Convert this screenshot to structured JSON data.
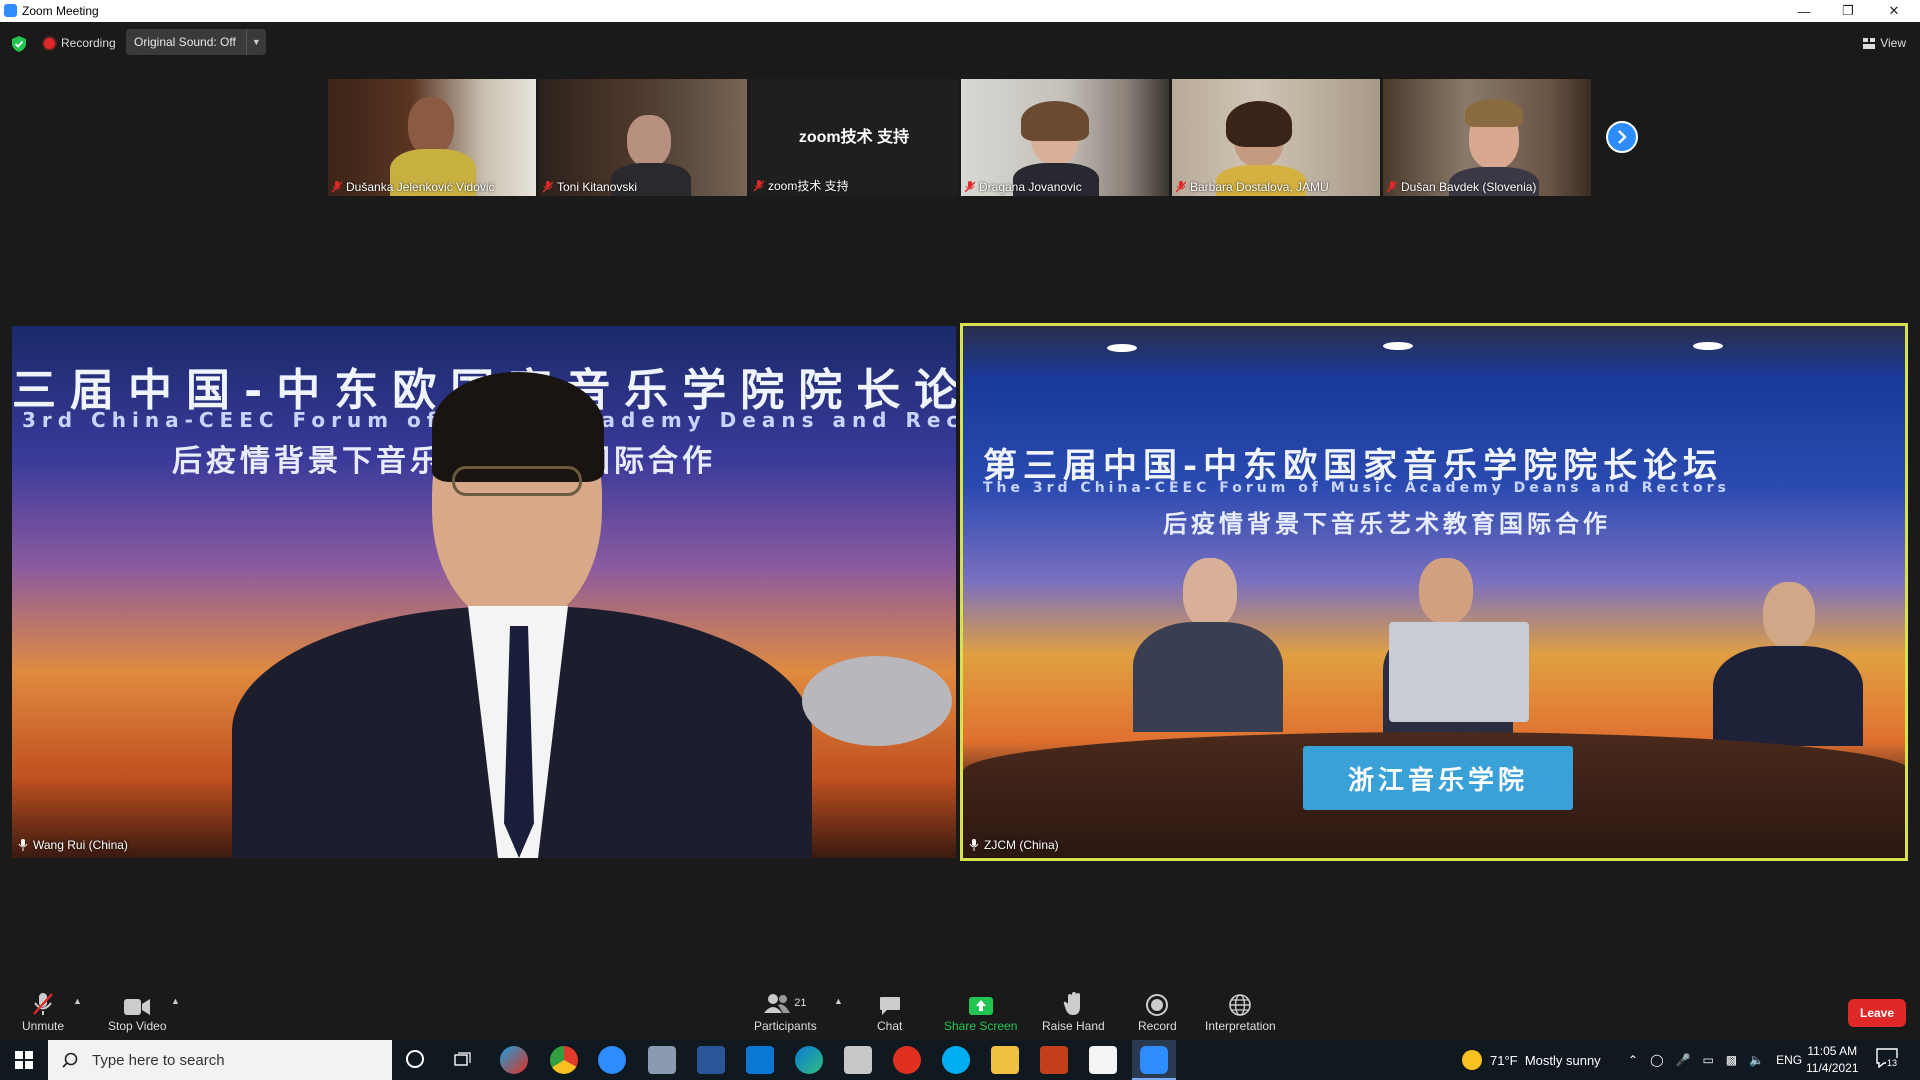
{
  "window": {
    "title": "Zoom Meeting"
  },
  "topbar": {
    "recording_label": "Recording",
    "original_sound_label": "Original Sound: Off",
    "view_label": "View"
  },
  "thumbnails": [
    {
      "name": "Dušanka Jelenković Vidović"
    },
    {
      "name": "Toni Kitanovski"
    },
    {
      "name": "zoom技术 支持",
      "center_text": "zoom技术 支持"
    },
    {
      "name": "Dragana Jovanovic"
    },
    {
      "name": "Barbara Dostalova, JAMU"
    },
    {
      "name": "Dušan Bavdek (Slovenia)"
    }
  ],
  "main_videos": {
    "left": {
      "name": "Wang Rui (China)",
      "banner_line1": "三届中国-中东欧国家音乐学院院长论",
      "banner_line2": "3rd China-CEEC Forum of Music Academy Deans and Rec",
      "banner_line3": "后疫情背景下音乐艺术教育国际合作"
    },
    "right": {
      "name": "ZJCM (China)",
      "banner_line1": "第三届中国-中东欧国家音乐学院院长论坛",
      "banner_line2": "The 3rd China-CEEC Forum of Music Academy Deans and Rectors",
      "banner_line3": "后疫情背景下音乐艺术教育国际合作",
      "sign_text": "浙江音乐学院"
    }
  },
  "toolbar": {
    "unmute_label": "Unmute",
    "stop_video_label": "Stop Video",
    "participants_label": "Participants",
    "participants_count": "21",
    "chat_label": "Chat",
    "share_screen_label": "Share Screen",
    "raise_hand_label": "Raise Hand",
    "record_label": "Record",
    "interpretation_label": "Interpretation",
    "leave_label": "Leave"
  },
  "taskbar": {
    "search_placeholder": "Type here to search",
    "weather": "71°F  Mostly sunny",
    "language": "ENG",
    "time": "11:05 AM",
    "date": "11/4/2021",
    "notification_count": "13"
  },
  "colors": {
    "accent": "#2d8cff",
    "recording": "#e02828",
    "active_speaker_border": "#d8e24c",
    "share_screen": "#23c552"
  }
}
